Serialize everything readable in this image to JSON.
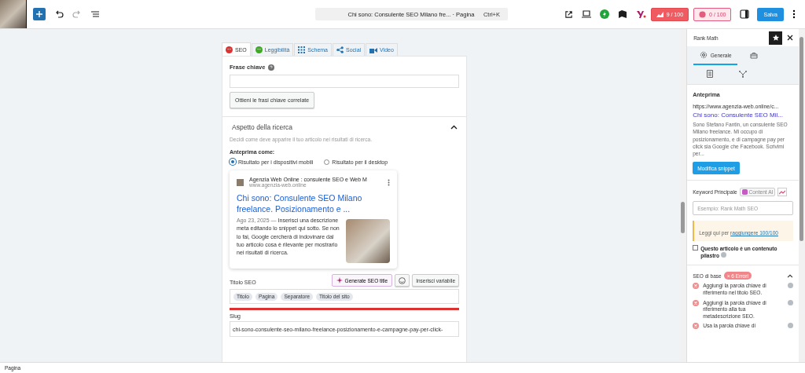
{
  "toolbar": {
    "command_title": "Chi sono: Consulente SEO Milano fre...",
    "command_type": "· Pagina",
    "shortcut": "Ctrl+K",
    "seo_score": "9 / 100",
    "readability_score": "0 / 100",
    "save": "Salva"
  },
  "yoast": {
    "tabs": [
      {
        "label": "SEO",
        "selected": true
      },
      {
        "label": "Leggibilità",
        "selected": false
      },
      {
        "label": "Schema",
        "selected": false
      },
      {
        "label": "Social",
        "selected": false
      },
      {
        "label": "Video",
        "selected": false
      }
    ],
    "keyphrase_label": "Frase chiave",
    "related_button": "Ottieni le frasi chiave correlate",
    "search_section": {
      "title": "Aspetto della ricerca",
      "expanded": true,
      "description": "Decidi come deve apparire il tuo articolo nei risultati di ricerca.",
      "preview_label": "Anteprima come:",
      "modes": [
        {
          "label": "Risultato per i dispositivi mobili",
          "selected": true
        },
        {
          "label": "Risultato per il desktop",
          "selected": false
        }
      ],
      "card": {
        "site_name": "Agenzia Web Online : consulente SEO e Web M",
        "url": "www.agenzia-web.online",
        "title": "Chi sono: Consulente SEO Milano freelance. Posizionamento e ...",
        "date": "Ago 23, 2025",
        "dash": "—",
        "description": "Inserisci una descrizione meta editando lo snippet qui sotto. Se non lo fai, Google cercherà di indovinare dal tuo articolo cosa è rilevante per mostrarlo nei risultati di ricerca."
      },
      "seo_title_label": "Titolo SEO",
      "generate_button": "Generate SEO title",
      "insert_button": "Inserisci variabile",
      "title_tags": [
        "Titolo",
        "Pagina",
        "Separatore",
        "Titolo del sito"
      ],
      "title_length_bar": {
        "level": 1
      },
      "slug_label": "Slug",
      "slug": "chi-sono-consulente-seo-milano-freelance-posizionamento-e-campagne-pay-per-click-"
    }
  },
  "sidebar": {
    "title": "Rank Math",
    "tabs": [
      {
        "label": "Generale",
        "selected": true
      },
      {
        "selected": false
      },
      {
        "selected": false
      },
      {
        "selected": false
      }
    ],
    "preview": {
      "heading": "Anteprima",
      "url": "https://www.agenzia-web.online/c...",
      "title": "Chi sono: Consulente SEO Mil...",
      "description": "Sono Stefano Fantin, un consulente SEO Milano freelance. Mi occupo di posizionamento, e di campagne pay per click sia Google che Facebook. Scrivimi per...",
      "edit_button": "Modifica snippet"
    },
    "keyword_label": "Keyword Principale",
    "content_ai": "Content AI",
    "keyword_placeholder": "Esempio: Rank Math SEO",
    "notice_text": "Leggi qui per",
    "notice_link": "raggiungere 100/100",
    "pillar": {
      "label": "Questo articolo è un contenuto pilastro",
      "checked": false
    },
    "basic_seo": {
      "title": "SEO di base",
      "badge": "× 6 Errori",
      "expanded": true,
      "checks": [
        {
          "kind": "error",
          "text": "Aggiungi la parola chiave di riferimento nel titolo SEO."
        },
        {
          "kind": "error",
          "text": "Aggiungi la parola chiave di riferimento alla tua metadescrizione SEO."
        },
        {
          "kind": "error",
          "text": "Usa la parola chiave di"
        }
      ]
    }
  },
  "status_bar": "Pagina"
}
